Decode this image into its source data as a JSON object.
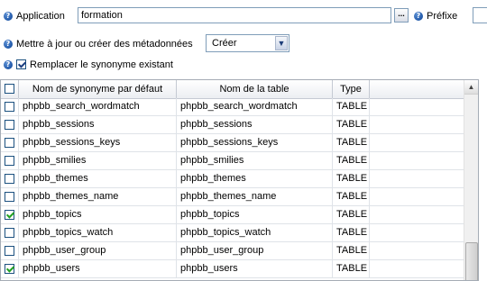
{
  "application": {
    "label": "Application",
    "value": "formation",
    "browse_label": "...",
    "prefix_label": "Préfixe"
  },
  "update": {
    "label": "Mettre à jour ou créer des métadonnées",
    "selected": "Créer"
  },
  "replace": {
    "label": "Remplacer le synonyme existant",
    "checked": true
  },
  "table": {
    "columns": [
      "Nom de synonyme par défaut",
      "Nom de la table",
      "Type"
    ],
    "rows": [
      {
        "checked": false,
        "synonym": "phpbb_search_wordmatch",
        "table": "phpbb_search_wordmatch",
        "type": "TABLE"
      },
      {
        "checked": false,
        "synonym": "phpbb_sessions",
        "table": "phpbb_sessions",
        "type": "TABLE"
      },
      {
        "checked": false,
        "synonym": "phpbb_sessions_keys",
        "table": "phpbb_sessions_keys",
        "type": "TABLE"
      },
      {
        "checked": false,
        "synonym": "phpbb_smilies",
        "table": "phpbb_smilies",
        "type": "TABLE"
      },
      {
        "checked": false,
        "synonym": "phpbb_themes",
        "table": "phpbb_themes",
        "type": "TABLE"
      },
      {
        "checked": false,
        "synonym": "phpbb_themes_name",
        "table": "phpbb_themes_name",
        "type": "TABLE"
      },
      {
        "checked": true,
        "synonym": "phpbb_topics",
        "table": "phpbb_topics",
        "type": "TABLE"
      },
      {
        "checked": false,
        "synonym": "phpbb_topics_watch",
        "table": "phpbb_topics_watch",
        "type": "TABLE"
      },
      {
        "checked": false,
        "synonym": "phpbb_user_group",
        "table": "phpbb_user_group",
        "type": "TABLE"
      },
      {
        "checked": true,
        "synonym": "phpbb_users",
        "table": "phpbb_users",
        "type": "TABLE"
      }
    ]
  }
}
